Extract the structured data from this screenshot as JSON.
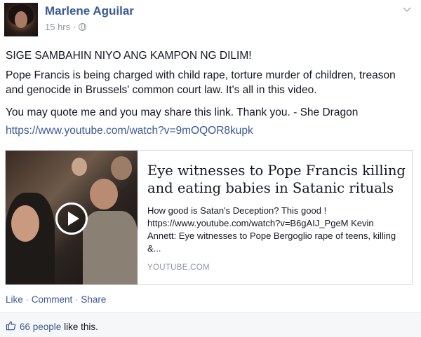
{
  "post": {
    "author": "Marlene Aguilar",
    "time": "15 hrs",
    "time_sep": "·",
    "privacy_icon": "globe-icon",
    "menu_icon": "chevron-down-icon",
    "lines": [
      "SIGE SAMBAHIN NIYO ANG KAMPON NG DILIM!",
      "Pope Francis is being charged with child rape, torture murder of children, treason and genocide in Brussels' common court law. It's all in this video.",
      "You may quote me and you may share this link. Thank you. - She Dragon"
    ],
    "link": "https://www.youtube.com/watch?v=9mOQOR8kupk"
  },
  "share_card": {
    "title": "Eye witnesses to Pope Francis killing and eating babies in Satanic rituals",
    "description": "How good is Satan's Deception? This good ! https://www.youtube.com/watch?v=B6gAIJ_PgeM Kevin Annett: Eye witnesses to Pope Bergoglio rape of teens, killing &...",
    "domain": "YOUTUBE.COM",
    "play_icon": "play-icon"
  },
  "actions": {
    "like": "Like",
    "comment": "Comment",
    "share": "Share",
    "sep": "·"
  },
  "likes": {
    "count_text": "66 people",
    "suffix": "like this."
  },
  "colors": {
    "link": "#3b5998",
    "meta": "#9197a3",
    "text": "#141823"
  }
}
